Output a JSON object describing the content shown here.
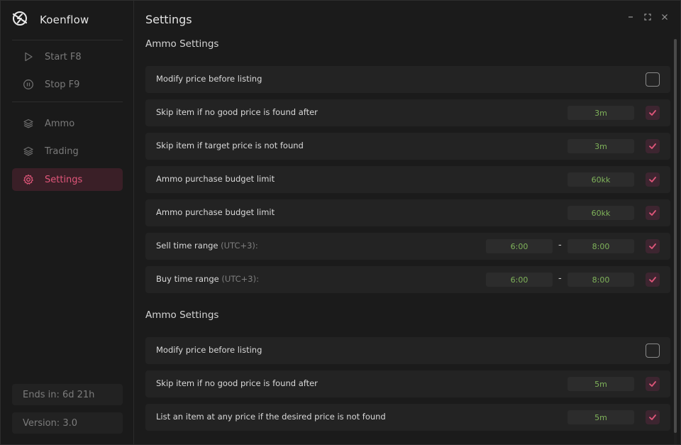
{
  "app": {
    "name": "Koenflow"
  },
  "colors": {
    "accent": "#e0567a",
    "active_bg": "#3a1f27",
    "value_green": "#7fb35a",
    "check_bg": "#3d2530"
  },
  "sidebar": {
    "items": [
      {
        "label": "Start F8",
        "icon": "play-icon"
      },
      {
        "label": "Stop F9",
        "icon": "pause-circle-icon"
      },
      {
        "label": "Ammo",
        "icon": "layers-icon"
      },
      {
        "label": "Trading",
        "icon": "layers-icon"
      },
      {
        "label": "Settings",
        "icon": "gear-icon",
        "active": true
      }
    ],
    "ends_in": "Ends in: 6d 21h",
    "version": "Version: 3.0"
  },
  "main": {
    "title": "Settings",
    "sections": [
      {
        "title": "Ammo Settings",
        "rows": [
          {
            "label": "Modify price before listing",
            "checked": false
          },
          {
            "label": "Skip item if no good price is found after",
            "value": "3m",
            "checked": true
          },
          {
            "label": "Skip item if target price is not found",
            "value": "3m",
            "checked": true
          },
          {
            "label": "Ammo purchase budget limit",
            "value": "60kk",
            "checked": true
          },
          {
            "label": "Ammo purchase budget limit",
            "value": "60kk",
            "checked": true
          },
          {
            "label": "Sell time range",
            "suffix": "(UTC+3):",
            "from": "6:00",
            "to": "8:00",
            "checked": true
          },
          {
            "label": "Buy time range",
            "suffix": "(UTC+3):",
            "from": "6:00",
            "to": "8:00",
            "checked": true
          }
        ]
      },
      {
        "title": "Ammo Settings",
        "rows": [
          {
            "label": "Modify price before listing",
            "checked": false
          },
          {
            "label": "Skip item if no good price is found after",
            "value": "5m",
            "checked": true
          },
          {
            "label": "List an item at any price if the desired price is not found",
            "value": "5m",
            "checked": true
          }
        ]
      }
    ],
    "range_separator": "-"
  }
}
